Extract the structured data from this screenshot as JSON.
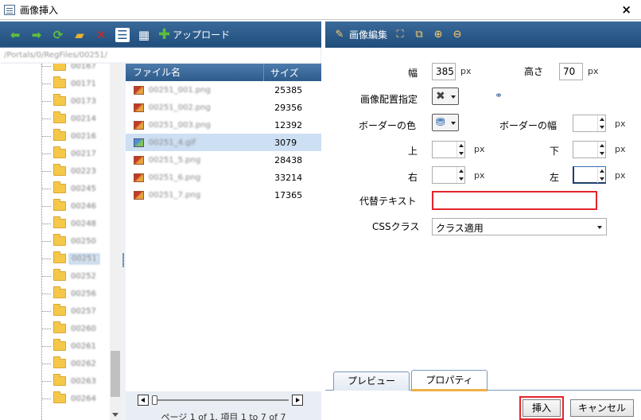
{
  "window": {
    "title": "画像挿入",
    "close_label": "×"
  },
  "toolbar_left": {
    "back_icon": "back-arrow-icon",
    "forward_icon": "forward-arrow-icon",
    "refresh_icon": "refresh-icon",
    "new_folder_icon": "new-folder-icon",
    "delete_icon": "delete-icon",
    "list_view_icon": "list-view-icon",
    "thumbnail_view_icon": "thumbnail-view-icon",
    "upload_label": "アップロード"
  },
  "path": "/Portals/0/RegFiles/00251/",
  "tree": {
    "items": [
      "00167",
      "00171",
      "00173",
      "00214",
      "00216",
      "00217",
      "00223",
      "00245",
      "00246",
      "00248",
      "00250",
      "00251",
      "00252",
      "00256",
      "00257",
      "00260",
      "00261",
      "00262",
      "00263",
      "00264"
    ],
    "selected": "00251"
  },
  "file_grid": {
    "columns": {
      "name": "ファイル名",
      "size": "サイズ"
    },
    "rows": [
      {
        "name": "00251_001.png",
        "size": "25385"
      },
      {
        "name": "00251_002.png",
        "size": "29356"
      },
      {
        "name": "00251_003.png",
        "size": "12392"
      },
      {
        "name": "00251_4.gif",
        "size": "3079"
      },
      {
        "name": "00251_5.png",
        "size": "28438"
      },
      {
        "name": "00251_6.png",
        "size": "33214"
      },
      {
        "name": "00251_7.png",
        "size": "17365"
      }
    ],
    "selected_index": 3,
    "pager_text": "ページ 1 of 1. 項目 1 to 7 of 7"
  },
  "toolbar_right": {
    "edit_label": "画像編集",
    "icons": [
      "crop-icon",
      "resize-icon",
      "zoom-in-icon",
      "zoom-out-icon"
    ]
  },
  "properties": {
    "width_label": "幅",
    "width_value": "385",
    "width_unit": "px",
    "height_label": "高さ",
    "height_value": "70",
    "height_unit": "px",
    "align_label": "画像配置指定",
    "border_color_label": "ボーダーの色",
    "border_width_label": "ボーダーの幅",
    "border_width_unit": "px",
    "top_label": "上",
    "top_unit": "px",
    "bottom_label": "下",
    "bottom_unit": "px",
    "right_label": "右",
    "right_unit": "px",
    "left_label": "左",
    "left_unit": "px",
    "alt_label": "代替テキスト",
    "alt_value": "",
    "css_label": "CSSクラス",
    "css_value": "クラス適用"
  },
  "tabs": {
    "preview": "プレビュー",
    "properties": "プロパティ",
    "active": "properties"
  },
  "buttons": {
    "insert": "挿入",
    "cancel": "キャンセル"
  },
  "colors": {
    "toolbar": "#2d5b8b",
    "highlight_red": "#e3252b",
    "tab_accent": "#f0b048",
    "selected_row": "#cddff3"
  }
}
